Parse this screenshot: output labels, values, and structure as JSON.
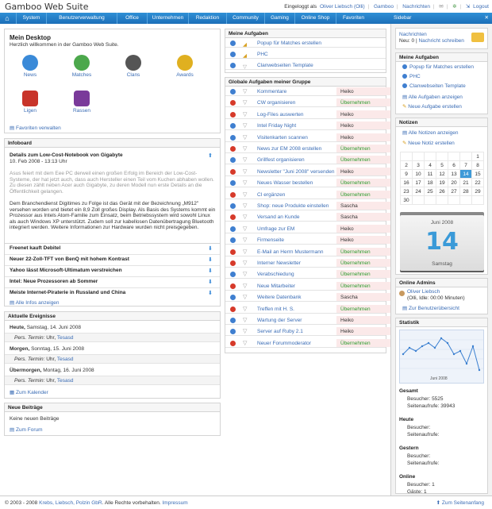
{
  "app": {
    "title": "Gamboo Web Suite",
    "logged_in_prefix": "Eingeloggt als",
    "user": "Oliver Liebsch (Olli)",
    "link_gamboo": "Gamboo",
    "link_messages": "Nachrichten",
    "link_logout": "Logout"
  },
  "nav": {
    "items": [
      "System",
      "Benutzerverwaltung",
      "Office",
      "Unternehmen",
      "Redaktion",
      "Community",
      "Gaming",
      "Online Shop",
      "Favoriten"
    ]
  },
  "desktop": {
    "title": "Mein Desktop",
    "subtitle": "Herzlich willkommen in der Gamboo Web Suite.",
    "icons": [
      {
        "label": "News",
        "color": "#3a8ad8"
      },
      {
        "label": "Matches",
        "color": "#4ca84c"
      },
      {
        "label": "Clans",
        "color": "#555555"
      },
      {
        "label": "Awards",
        "color": "#e0b020"
      },
      {
        "label": "Ligen",
        "color": "#c8342a"
      },
      {
        "label": "Rassen",
        "color": "#7a3a9a"
      }
    ],
    "favorites_link": "Favoriten verwalten"
  },
  "infoboard": {
    "title": "Infoboard",
    "main_title": "Details zum Low-Cost-Notebook von Gigabyte",
    "main_date": "10. Feb 2008 - 13:13 Uhr",
    "para1": "Asus feiert mit dem Eee PC derweil einen großen Erfolg im Bereich der Low-Cost-Systeme, der hat jetzt auch, dass auch Hersteller einen Teil vom Kuchen abhaben wollen. Zu diesen zählt neben Acer auch Gigabyte, zu deren Modell nun erste Details an die Öffentlichkeit gelangen.",
    "para2": "Dem Branchendienst Digitimes zu Folge ist das Gerät mit der Bezeichnung „M912\" versehen worden und bietet ein 8,9 Zoll großes Display. Als Basis des Systems kommt ein Prozessor aus Intels Atom-Familie zum Einsatz, beim Betriebssystem wird sowohl Linux als auch Windows XP unterstützt. Zudem soll zur kabellosen Datenübertragung Bluetooth integriert werden. Weitere Informationen zur Hardware wurden nicht preisgegeben.",
    "items": [
      "Freenet kauft Debitel",
      "Neuer 22-Zoll-TFT von BenQ mit hohem Kontrast",
      "Yahoo lässt Microsoft-Ultimatum verstreichen",
      "Intel: Neue Prozessoren ab Sommer",
      "Meiste Internet-Piraterie in Russland und China"
    ],
    "all_link": "Alle Infos anzeigen"
  },
  "events": {
    "title": "Aktuelle Ereignisse",
    "days": [
      {
        "label": "Heute,",
        "date": "Samstag, 14. Juni 2008",
        "pers": "Pers. Termin:",
        "uhr": "Uhr,",
        "name": "Tesasd"
      },
      {
        "label": "Morgen,",
        "date": "Sonntag, 15. Juni 2008",
        "pers": "Pers. Termin:",
        "uhr": "Uhr,",
        "name": "Tesasd"
      },
      {
        "label": "Übermorgen,",
        "date": "Montag, 16. Juni 2008",
        "pers": "Pers. Termin:",
        "uhr": "Uhr,",
        "name": "Tesasd"
      }
    ],
    "calendar_link": "Zum Kalender"
  },
  "posts": {
    "title": "Neue Beiträge",
    "empty": "Keine neuen Beiträge",
    "forum_link": "Zum Forum"
  },
  "my_tasks": {
    "title": "Meine Aufgaben",
    "items": [
      "Popup für Matches erstellen",
      "PHC",
      "Clanwebseiten Template"
    ]
  },
  "group_tasks": {
    "title": "Globale Aufgaben meiner Gruppe",
    "rows": [
      {
        "status": "b",
        "text": "Kommentare",
        "who": "Heiko",
        "green": false
      },
      {
        "status": "r",
        "text": "CW organisieren",
        "who": "Übernehmen",
        "green": true
      },
      {
        "status": "r",
        "text": "Log-Files auswerten",
        "who": "Heiko",
        "green": false
      },
      {
        "status": "b",
        "text": "Intel Friday Night",
        "who": "Heiko",
        "green": false
      },
      {
        "status": "b",
        "text": "Visitenkarten scannen",
        "who": "Heiko",
        "green": false
      },
      {
        "status": "r",
        "text": "News zur EM 2008 erstellen",
        "who": "Übernehmen",
        "green": true
      },
      {
        "status": "b",
        "text": "Grillfest organisieren",
        "who": "Übernehmen",
        "green": true
      },
      {
        "status": "r",
        "text": "Newsletter \"Juni 2008\" versenden",
        "who": "Heiko",
        "green": false
      },
      {
        "status": "b",
        "text": "Neues Wasser bestellen",
        "who": "Übernehmen",
        "green": true
      },
      {
        "status": "r",
        "text": "CI ergänzen",
        "who": "Übernehmen",
        "green": true
      },
      {
        "status": "b",
        "text": "Shop: neue Produkte einstellen",
        "who": "Sascha",
        "green": false
      },
      {
        "status": "r",
        "text": "Versand an Kunde",
        "who": "Sascha",
        "green": false
      },
      {
        "status": "b",
        "text": "Umfrage zur EM",
        "who": "Heiko",
        "green": false
      },
      {
        "status": "b",
        "text": "Firmenseite",
        "who": "Heiko",
        "green": false
      },
      {
        "status": "r",
        "text": "E-Mail an Herrn Mustermann",
        "who": "Übernehmen",
        "green": true
      },
      {
        "status": "r",
        "text": "Interner Newsletter",
        "who": "Übernehmen",
        "green": true
      },
      {
        "status": "b",
        "text": "Verabschiedung",
        "who": "Übernehmen",
        "green": true
      },
      {
        "status": "r",
        "text": "Neue Mitarbeiter",
        "who": "Übernehmen",
        "green": true
      },
      {
        "status": "b",
        "text": "Weitere Datenbank",
        "who": "Sascha",
        "green": false
      },
      {
        "status": "r",
        "text": "Treffen mit H. S.",
        "who": "Übernehmen",
        "green": true
      },
      {
        "status": "b",
        "text": "Wartung der Server",
        "who": "Heiko",
        "green": false
      },
      {
        "status": "b",
        "text": "Server auf Ruby 2.1",
        "who": "Heiko",
        "green": false
      },
      {
        "status": "r",
        "text": "Neuer Forummoderator",
        "who": "Übernehmen",
        "green": true
      }
    ]
  },
  "sidebar": {
    "title": "Sidebar",
    "messages_link": "Nachrichten",
    "messages_count": "Neu: 0",
    "messages_write": "Nachricht schreiben",
    "tasks_title": "Meine Aufgaben",
    "tasks": [
      "Popup für Matches erstellen",
      "PHC",
      "Clanwebseiten Template"
    ],
    "tasks_all": "Alle Aufgaben anzeigen",
    "tasks_new": "Neue Aufgabe erstellen",
    "notes_title": "Notizen",
    "notes_all": "Alle Notizen anzeigen",
    "notes_new": "Neue Notiz erstellen",
    "calendar": [
      [
        "",
        "",
        "",
        "",
        "",
        "",
        "1"
      ],
      [
        "2",
        "3",
        "4",
        "5",
        "6",
        "7",
        "8"
      ],
      [
        "9",
        "10",
        "11",
        "12",
        "13",
        "14",
        "15"
      ],
      [
        "16",
        "17",
        "18",
        "19",
        "20",
        "21",
        "22"
      ],
      [
        "23",
        "24",
        "25",
        "26",
        "27",
        "28",
        "29"
      ],
      [
        "30",
        "",
        "",
        "",
        "",
        "",
        ""
      ]
    ],
    "cal_month": "Juni 2008",
    "cal_day": "14",
    "cal_weekday": "Samstag",
    "admins_title": "Online Admins",
    "admin_name": "Oliver Liebsch",
    "admin_idle": "(Olli, Idle: 00:00 Minuten)",
    "admins_link": "Zur Benutzerübersicht",
    "stats_title": "Statistik",
    "stats_chart_month": "Juni 2008",
    "stats": [
      {
        "label": "Gesamt",
        "lines": [
          "Besucher: 5525",
          "Seitenaufrufe: 39943"
        ]
      },
      {
        "label": "Heute",
        "lines": [
          "Besucher:",
          "Seitenaufrufe:"
        ]
      },
      {
        "label": "Gestern",
        "lines": [
          "Besucher:",
          "Seitenaufrufe:"
        ]
      },
      {
        "label": "Online",
        "lines": [
          "Besucher: 1",
          "Gäste: 1"
        ]
      }
    ]
  },
  "footer": {
    "copy": "© 2003 - 2008",
    "company": "Krebs, Liebsch, Polzin GbR",
    "rights": ". Alle Rechte vorbehalten.",
    "impressum": "Impressum",
    "top_link": "Zum Seitenanfang"
  }
}
